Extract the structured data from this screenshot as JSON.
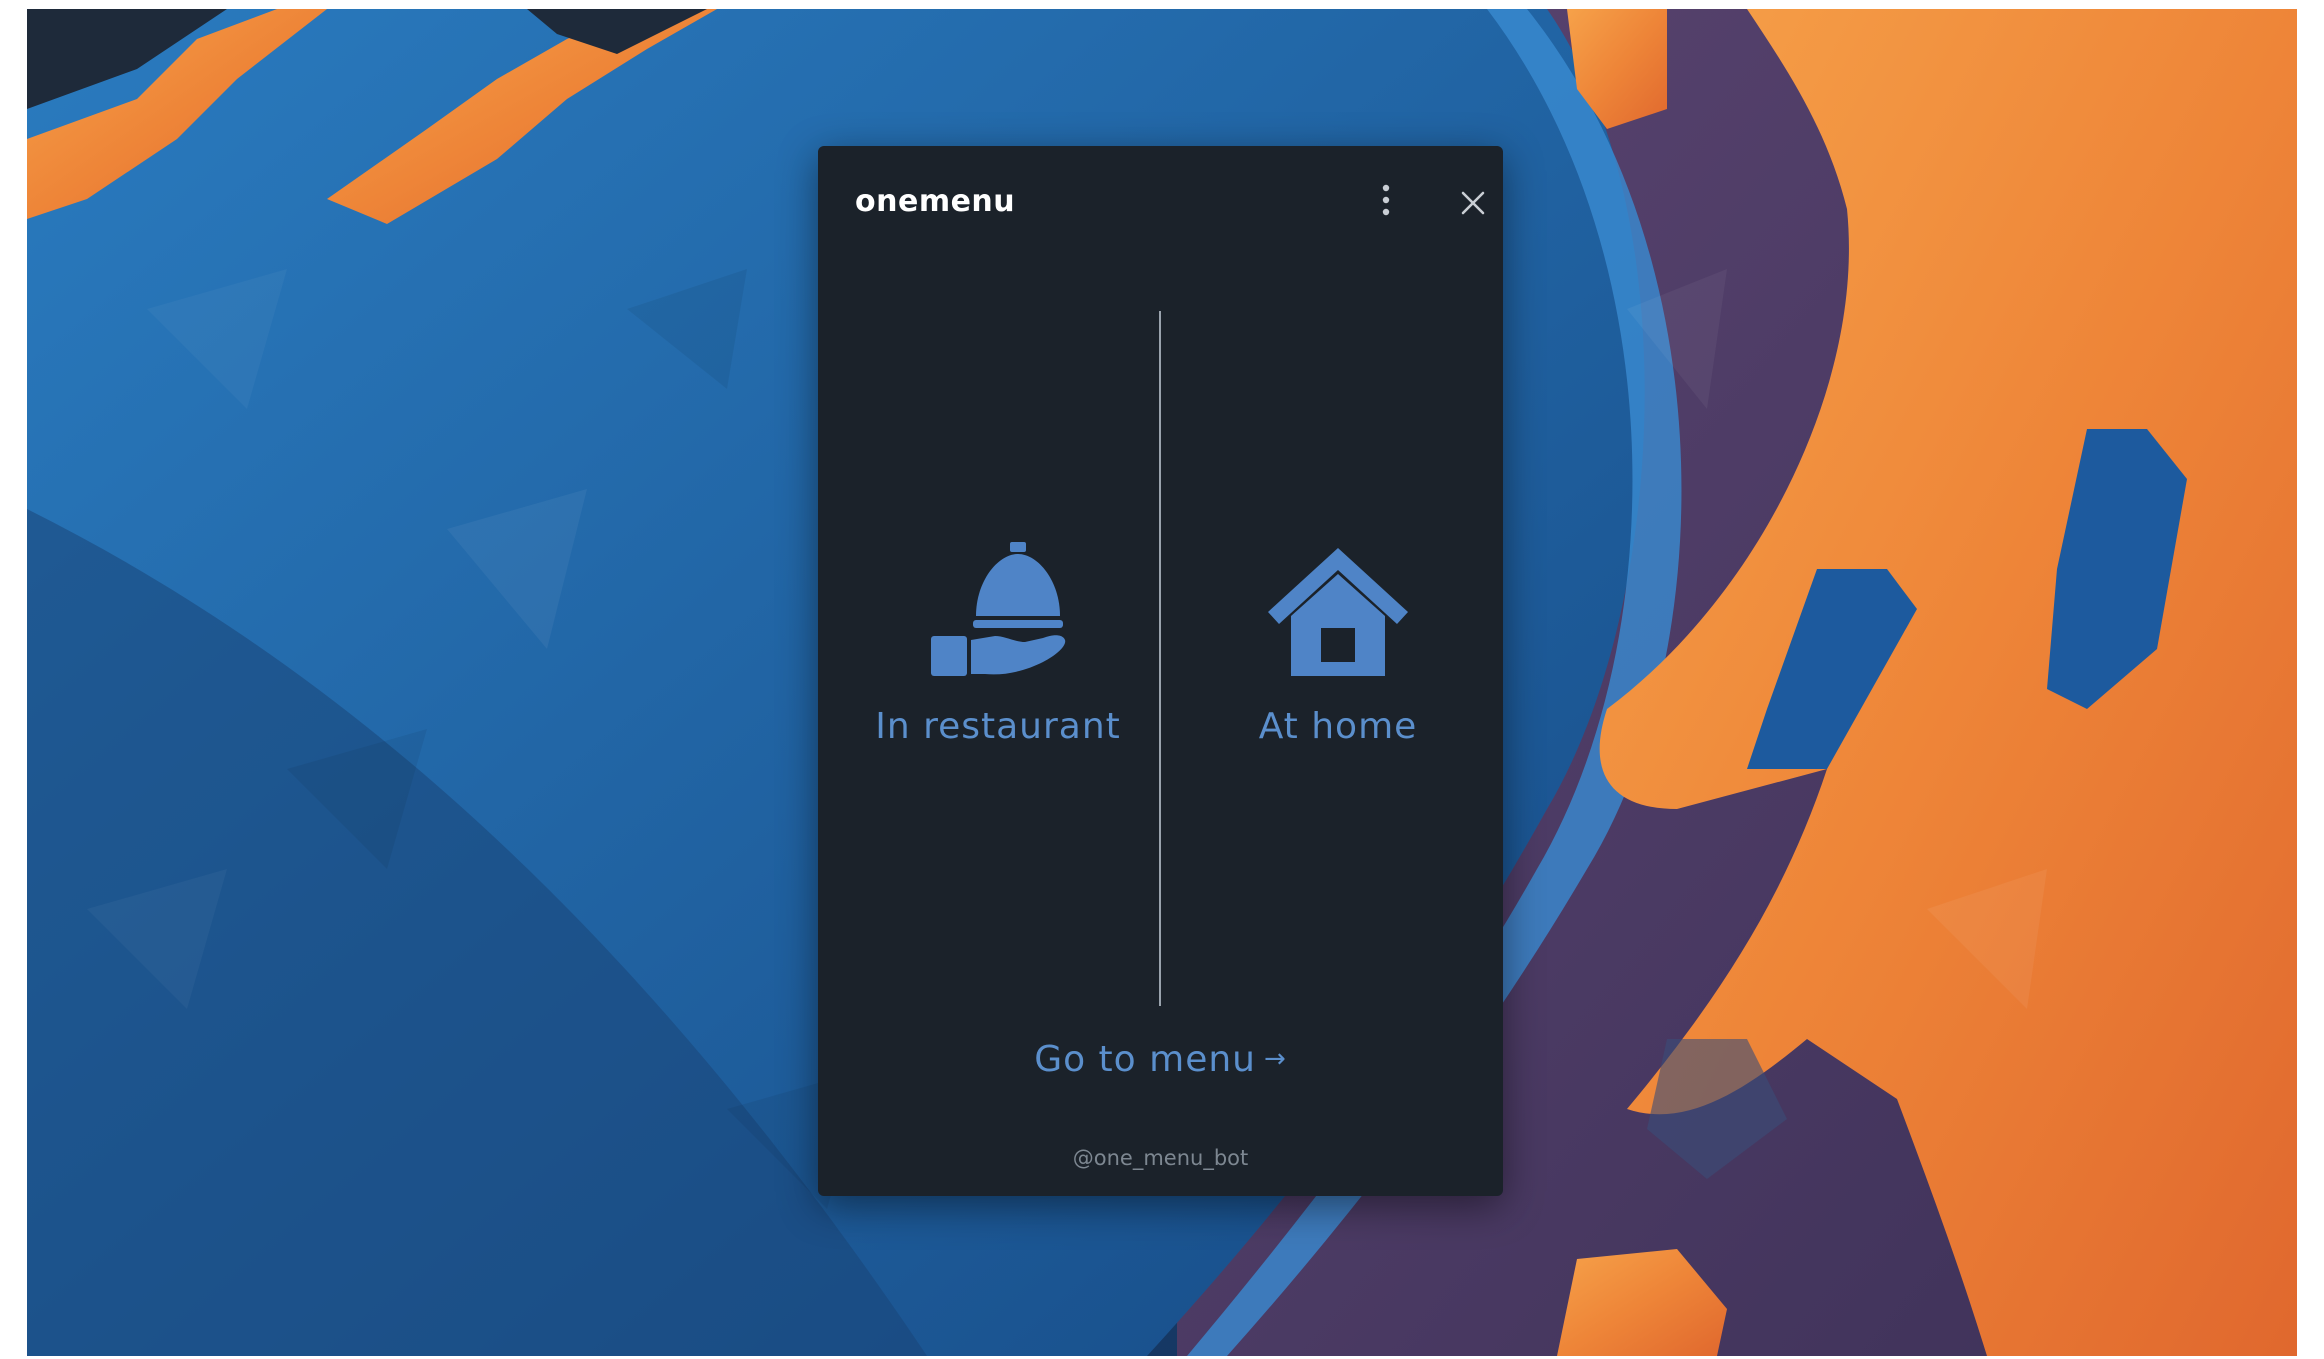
{
  "window": {
    "title": "onemenu",
    "menu_icon": "more-vertical-icon",
    "close_icon": "close-icon"
  },
  "options": [
    {
      "label": "In restaurant",
      "icon": "cloche-serving-icon"
    },
    {
      "label": "At home",
      "icon": "home-icon"
    }
  ],
  "actions": {
    "go_to_menu_label": "Go to menu",
    "go_to_menu_arrow": "→"
  },
  "footer": {
    "handle": "@one_menu_bot"
  },
  "colors": {
    "window_bg": "#1b222a",
    "accent": "#5b8fcc",
    "icon": "#4f84c7",
    "title": "#ffffff",
    "footer": "#7d8791",
    "wallpaper_orange": "#f08a3a",
    "wallpaper_blue": "#1f5fa0"
  }
}
